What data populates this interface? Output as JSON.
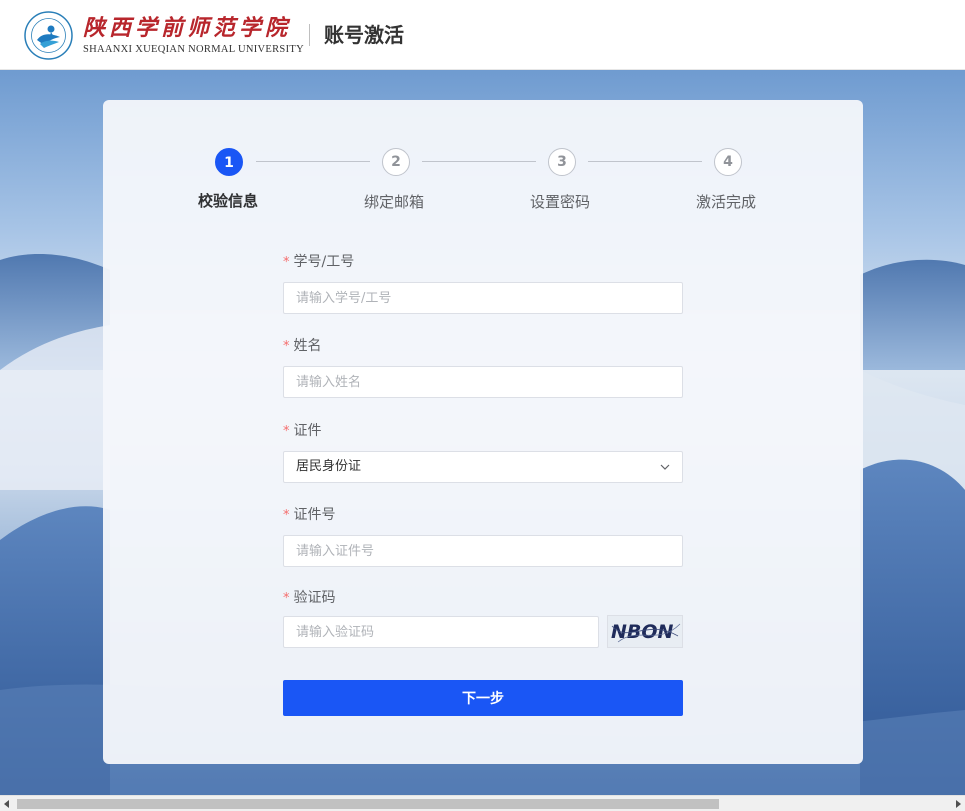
{
  "header": {
    "school_cn": "陕西学前师范学院",
    "school_en": "SHAANXI XUEQIAN NORMAL UNIVERSITY",
    "title": "账号激活"
  },
  "steps": [
    {
      "number": "1",
      "label": "校验信息",
      "active": true
    },
    {
      "number": "2",
      "label": "绑定邮箱",
      "active": false
    },
    {
      "number": "3",
      "label": "设置密码",
      "active": false
    },
    {
      "number": "4",
      "label": "激活完成",
      "active": false
    }
  ],
  "form": {
    "required_mark": "*",
    "student_id": {
      "label": "学号/工号",
      "placeholder": "请输入学号/工号",
      "value": ""
    },
    "name": {
      "label": "姓名",
      "placeholder": "请输入姓名",
      "value": ""
    },
    "id_type": {
      "label": "证件",
      "selected": "居民身份证"
    },
    "id_number": {
      "label": "证件号",
      "placeholder": "请输入证件号",
      "value": ""
    },
    "captcha": {
      "label": "验证码",
      "placeholder": "请输入验证码",
      "value": "",
      "image_text": "NBON"
    },
    "next_label": "下一步"
  },
  "colors": {
    "primary": "#1a56f5",
    "required": "#f56c6c",
    "logo_red": "#b8262c"
  },
  "icons": {
    "emblem": "school-emblem-icon",
    "select_arrow": "chevron-down-icon"
  }
}
